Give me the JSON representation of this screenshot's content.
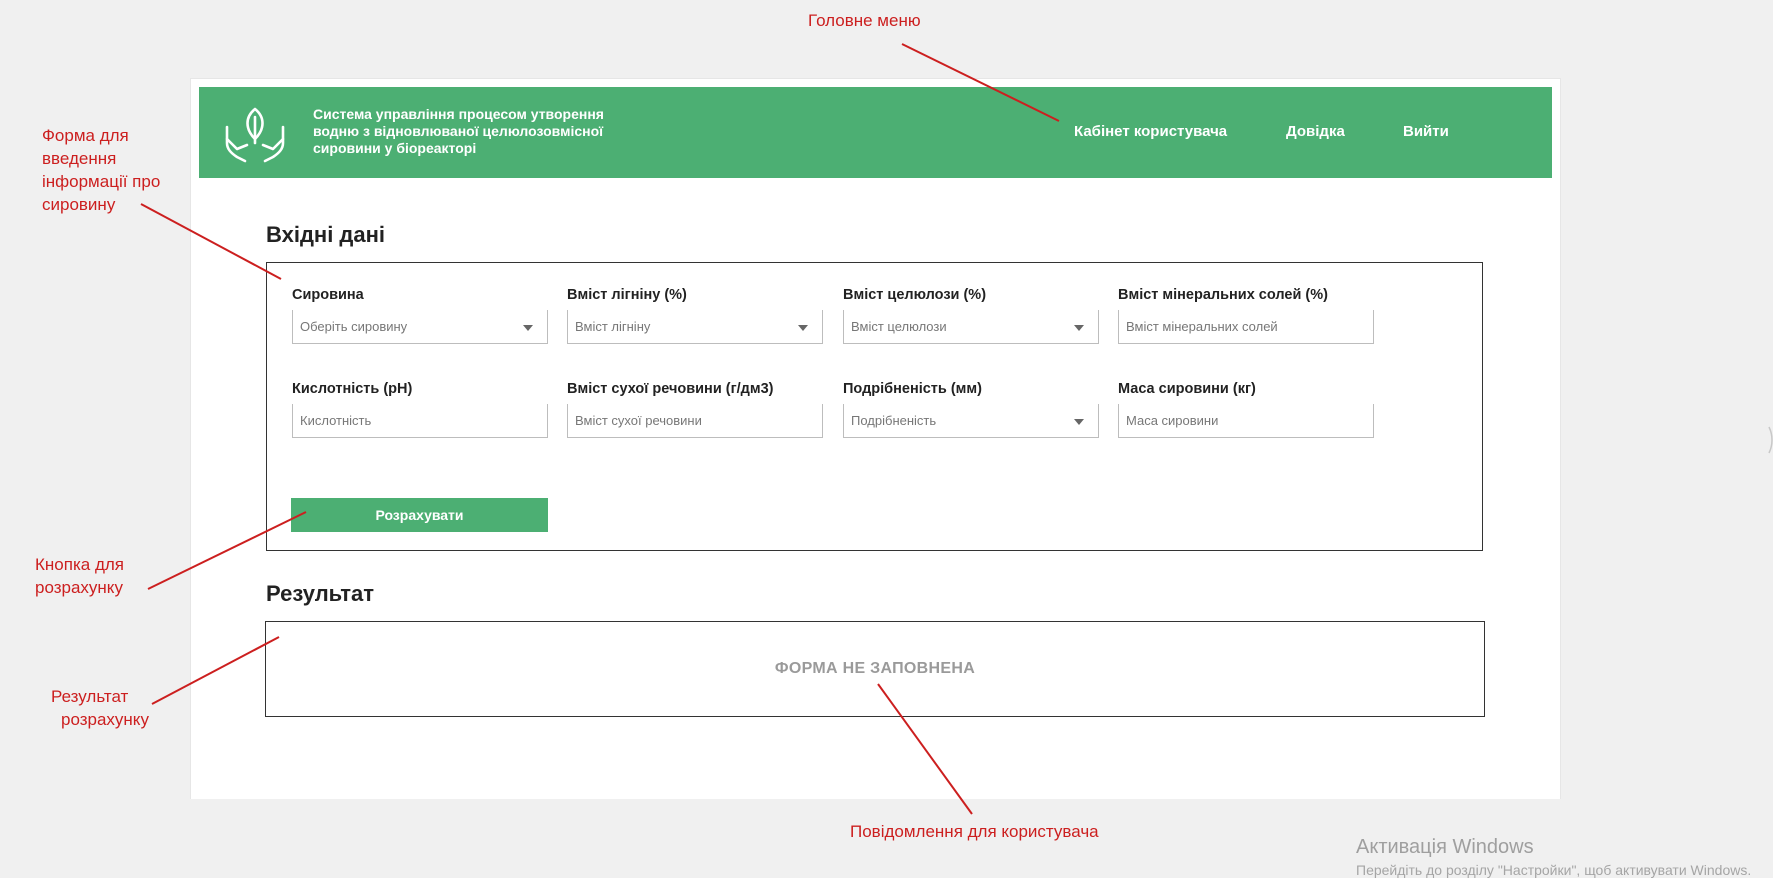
{
  "header": {
    "app_title": "Система управління процесом утворення водню з відновлюваної целюлозовмісної сировини у біореакторі",
    "nav": [
      "Кабінет користувача",
      "Довідка",
      "Вийти"
    ],
    "logo_icon": "hands-leaf-icon",
    "color": "#4caf73"
  },
  "input_section": {
    "title": "Вхідні дані",
    "fields": [
      {
        "label": "Сировина",
        "placeholder": "Оберіть сировину",
        "type": "select"
      },
      {
        "label": "Вміст лігніну (%)",
        "placeholder": "Вміст лігніну",
        "type": "select"
      },
      {
        "label": "Вміст целюлози (%)",
        "placeholder": "Вміст целюлози",
        "type": "select"
      },
      {
        "label": "Вміст мінеральних солей (%)",
        "placeholder": "Вміст мінеральних солей",
        "type": "input"
      },
      {
        "label": "Кислотність (pH)",
        "placeholder": "Кислотність",
        "type": "input"
      },
      {
        "label": "Вміст сухої речовини (г/дм3)",
        "placeholder": "Вміст сухої речовини",
        "type": "input"
      },
      {
        "label": "Подрібненість (мм)",
        "placeholder": "Подрібненість",
        "type": "select"
      },
      {
        "label": "Маса сировини (кг)",
        "placeholder": "Маса сировини",
        "type": "input"
      }
    ],
    "calculate_label": "Розрахувати"
  },
  "result_section": {
    "title": "Результат",
    "message": "ФОРМА НЕ ЗАПОВНЕНА"
  },
  "annotations": {
    "main_menu": "Головне меню",
    "form": [
      "Форма для",
      "введення",
      "інформації про",
      "сировину"
    ],
    "calc_button": [
      "Кнопка для",
      "розрахунку"
    ],
    "result": [
      "Результат",
      "розрахунку"
    ],
    "user_message": "Повідомлення для користувача",
    "color": "#cc1f1f"
  },
  "watermark": {
    "title": "Активація Windows",
    "subtitle": "Перейдіть до розділу \"Настройки\", щоб активувати Windows."
  }
}
